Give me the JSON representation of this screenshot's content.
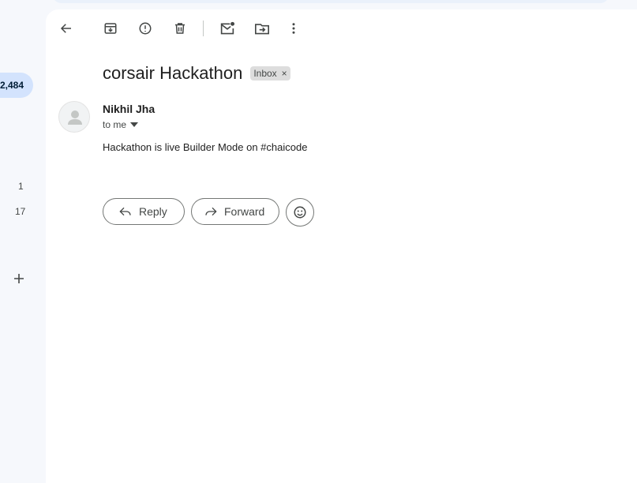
{
  "sidebar": {
    "inbox_count": "2,484",
    "counts": [
      "1",
      "17"
    ]
  },
  "toolbar": {
    "icons": [
      "back-arrow-icon",
      "archive-icon",
      "report-spam-icon",
      "delete-icon",
      "mark-unread-icon",
      "move-to-icon",
      "more-vert-icon"
    ]
  },
  "email": {
    "subject": "corsair Hackathon",
    "label": "Inbox",
    "label_remove": "×",
    "sender": "Nikhil Jha",
    "recipient": "to me",
    "body": "Hackathon is live Builder Mode on #chaicode"
  },
  "actions": {
    "reply": "Reply",
    "forward": "Forward"
  },
  "colors": {
    "background": "#f6f8fc",
    "pill": "#d3e3fd",
    "chip": "#dddddd",
    "icon": "#444746"
  }
}
